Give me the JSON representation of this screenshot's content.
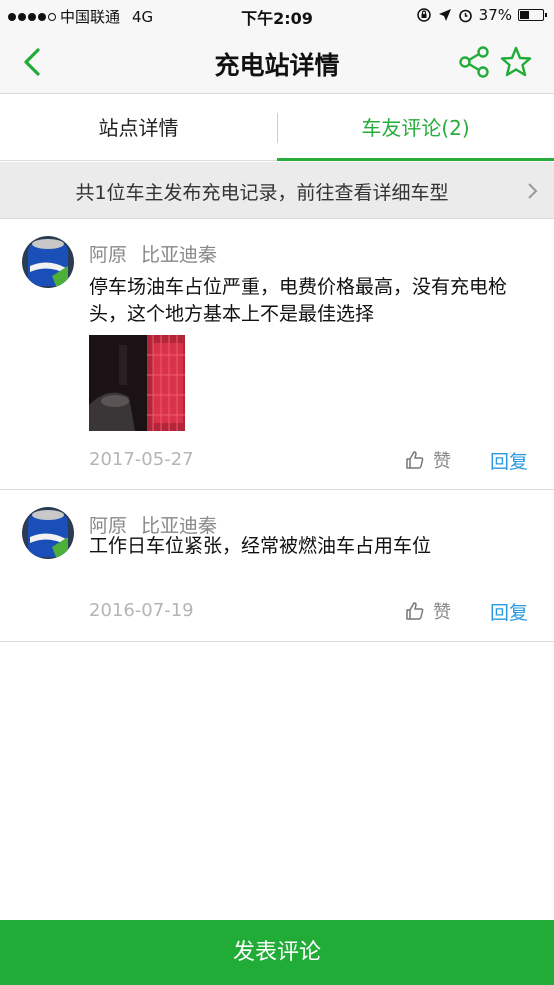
{
  "status_bar": {
    "carrier": "中国联通",
    "network": "4G",
    "time": "下午2:09",
    "battery": "37%",
    "battery_level": 0.37
  },
  "nav": {
    "title": "充电站详情"
  },
  "tabs": [
    {
      "label": "站点详情"
    },
    {
      "label": "车友评论(2)"
    }
  ],
  "banner": {
    "text": "共1位车主发布充电记录，前往查看详细车型"
  },
  "comments": [
    {
      "user": "阿原",
      "car": "比亚迪秦",
      "text": "停车场油车占位严重，电费价格最高，没有充电枪头，这个地方基本上不是最佳选择",
      "date": "2017-05-27",
      "like_label": "赞",
      "reply_label": "回复"
    },
    {
      "user": "阿原",
      "car": "比亚迪秦",
      "text": "工作日车位紧张，经常被燃油车占用车位",
      "date": "2016-07-19",
      "like_label": "赞",
      "reply_label": "回复"
    }
  ],
  "bottom": {
    "post_label": "发表评论"
  },
  "colors": {
    "accent": "#21ac38",
    "reply": "#2a9ae0",
    "tab_active": "#26ad3c"
  }
}
